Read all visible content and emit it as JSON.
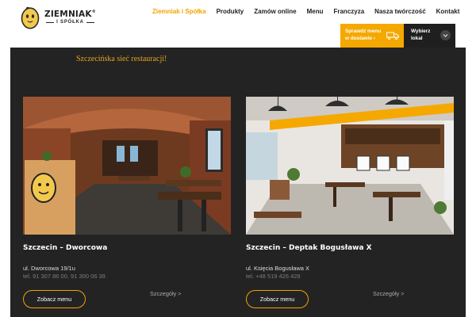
{
  "brand": {
    "name": "ZIEMNIAK",
    "sub": "I SPÓŁKA",
    "reg": "®"
  },
  "nav": [
    "Ziemniak i Spółka",
    "Produkty",
    "Zamów online",
    "Menu",
    "Franczyza",
    "Nasza twórczość",
    "Kontakt"
  ],
  "cta": {
    "delivery_line1": "Sprawdź menu",
    "delivery_line2": "w dostawie ›",
    "location_line1": "Wybierz",
    "location_line2": "lokal"
  },
  "tagline": "Szczecińska sieć restauracji!",
  "restaurants": [
    {
      "title": "Szczecin – Dworcowa",
      "address": "ul. Dworcowa 19/1u",
      "phone": "tel. 91 307 86 00, 91 300 06 39",
      "menu_label": "Zobacz menu",
      "details_label": "Szczegóły >"
    },
    {
      "title": "Szczecin – Deptak Bogusława X",
      "address": "ul. Księcia Bogusława X",
      "phone": "tel. +48 519 426 428",
      "menu_label": "Zobacz menu",
      "details_label": "Szczegóły >"
    }
  ],
  "colors": {
    "accent": "#f5a800",
    "dark": "#232323",
    "header_bg": "#ffffff"
  },
  "icons": [
    "potato-logo-icon",
    "delivery-truck-icon",
    "chevron-down-icon"
  ]
}
